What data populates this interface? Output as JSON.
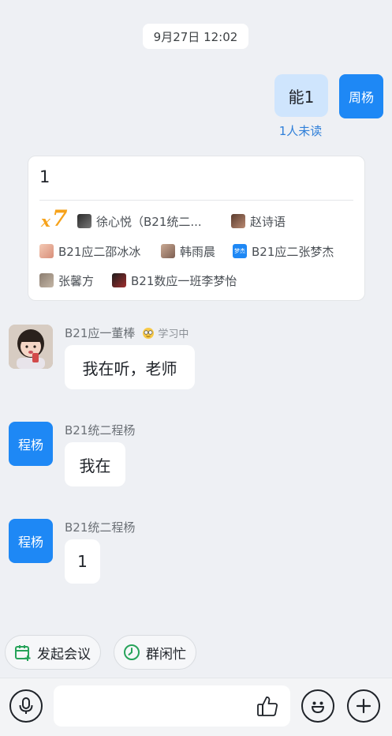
{
  "timestamp": "9月27日 12:02",
  "my_message": {
    "text": "能1",
    "avatar_label": "周杨",
    "read_status": "1人未读"
  },
  "reaction_card": {
    "text": "1",
    "reaction": {
      "prefix": "x",
      "count": "7"
    },
    "reactors": [
      "徐心悦（B21统二...",
      "赵诗语",
      "B21应二邵冰冰",
      "韩雨晨",
      "B21应二张梦杰",
      "张馨方",
      "B21数应一班李梦怡"
    ],
    "blue_avatar_label": "梦杰"
  },
  "messages": [
    {
      "sender": "B21应一董棒",
      "status": "学习中",
      "text": "我在听，老师"
    },
    {
      "sender": "B21统二程杨",
      "avatar_label": "程杨",
      "text": "我在"
    },
    {
      "sender": "B21统二程杨",
      "avatar_label": "程杨",
      "text": "1"
    }
  ],
  "quick_actions": {
    "meeting": "发起会议",
    "free_busy": "群闲忙"
  },
  "composer": {
    "placeholder": ""
  },
  "colors": {
    "accent": "#1e88f5",
    "my_bubble": "#cfe5fd",
    "reaction": "#f6a21a",
    "meeting_icon": "#27a35a"
  }
}
